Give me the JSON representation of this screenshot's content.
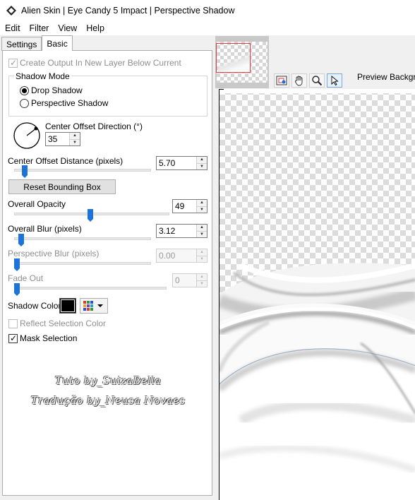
{
  "window": {
    "title": "Alien Skin | Eye Candy 5 Impact | Perspective Shadow"
  },
  "menu": [
    "Edit",
    "Filter",
    "View",
    "Help"
  ],
  "tabs": {
    "settings": "Settings",
    "basic": "Basic"
  },
  "options": {
    "create_output": "Create Output In New Layer Below Current",
    "shadow_mode_title": "Shadow Mode",
    "drop_shadow": "Drop Shadow",
    "perspective_shadow": "Perspective Shadow",
    "center_offset_direction": "Center Offset Direction (°)",
    "direction_value": "35",
    "center_offset_distance": "Center Offset Distance (pixels)",
    "distance_value": "5.70",
    "reset_bounding_box": "Reset Bounding Box",
    "overall_opacity": "Overall Opacity",
    "opacity_value": "49",
    "overall_blur": "Overall Blur (pixels)",
    "blur_value": "3.12",
    "perspective_blur": "Perspective Blur (pixels)",
    "perspective_blur_value": "0.00",
    "fade_out": "Fade Out",
    "fade_out_value": "0",
    "shadow_color": "Shadow Color",
    "reflect_selection_color": "Reflect Selection Color",
    "mask_selection": "Mask Selection"
  },
  "watermark": {
    "line1": "Tuto by_SuizaBella",
    "line2": "Tradução by_Neusa Novaes"
  },
  "preview": {
    "label": "Preview Backgro"
  },
  "colors": {
    "shadow": "#000000",
    "slider": "#1e73d6",
    "thumb_frame": "#e23a3a"
  },
  "slider_levels": {
    "distance": 0.06,
    "opacity": 0.49,
    "blur": 0.03,
    "perspective_blur": 0.0,
    "fade_out": 0.0
  },
  "icons": [
    "app-icon",
    "navigate-icon",
    "hand-icon",
    "zoom-icon",
    "pointer-icon",
    "color-grid-icon",
    "dropdown-arrow-icon"
  ]
}
